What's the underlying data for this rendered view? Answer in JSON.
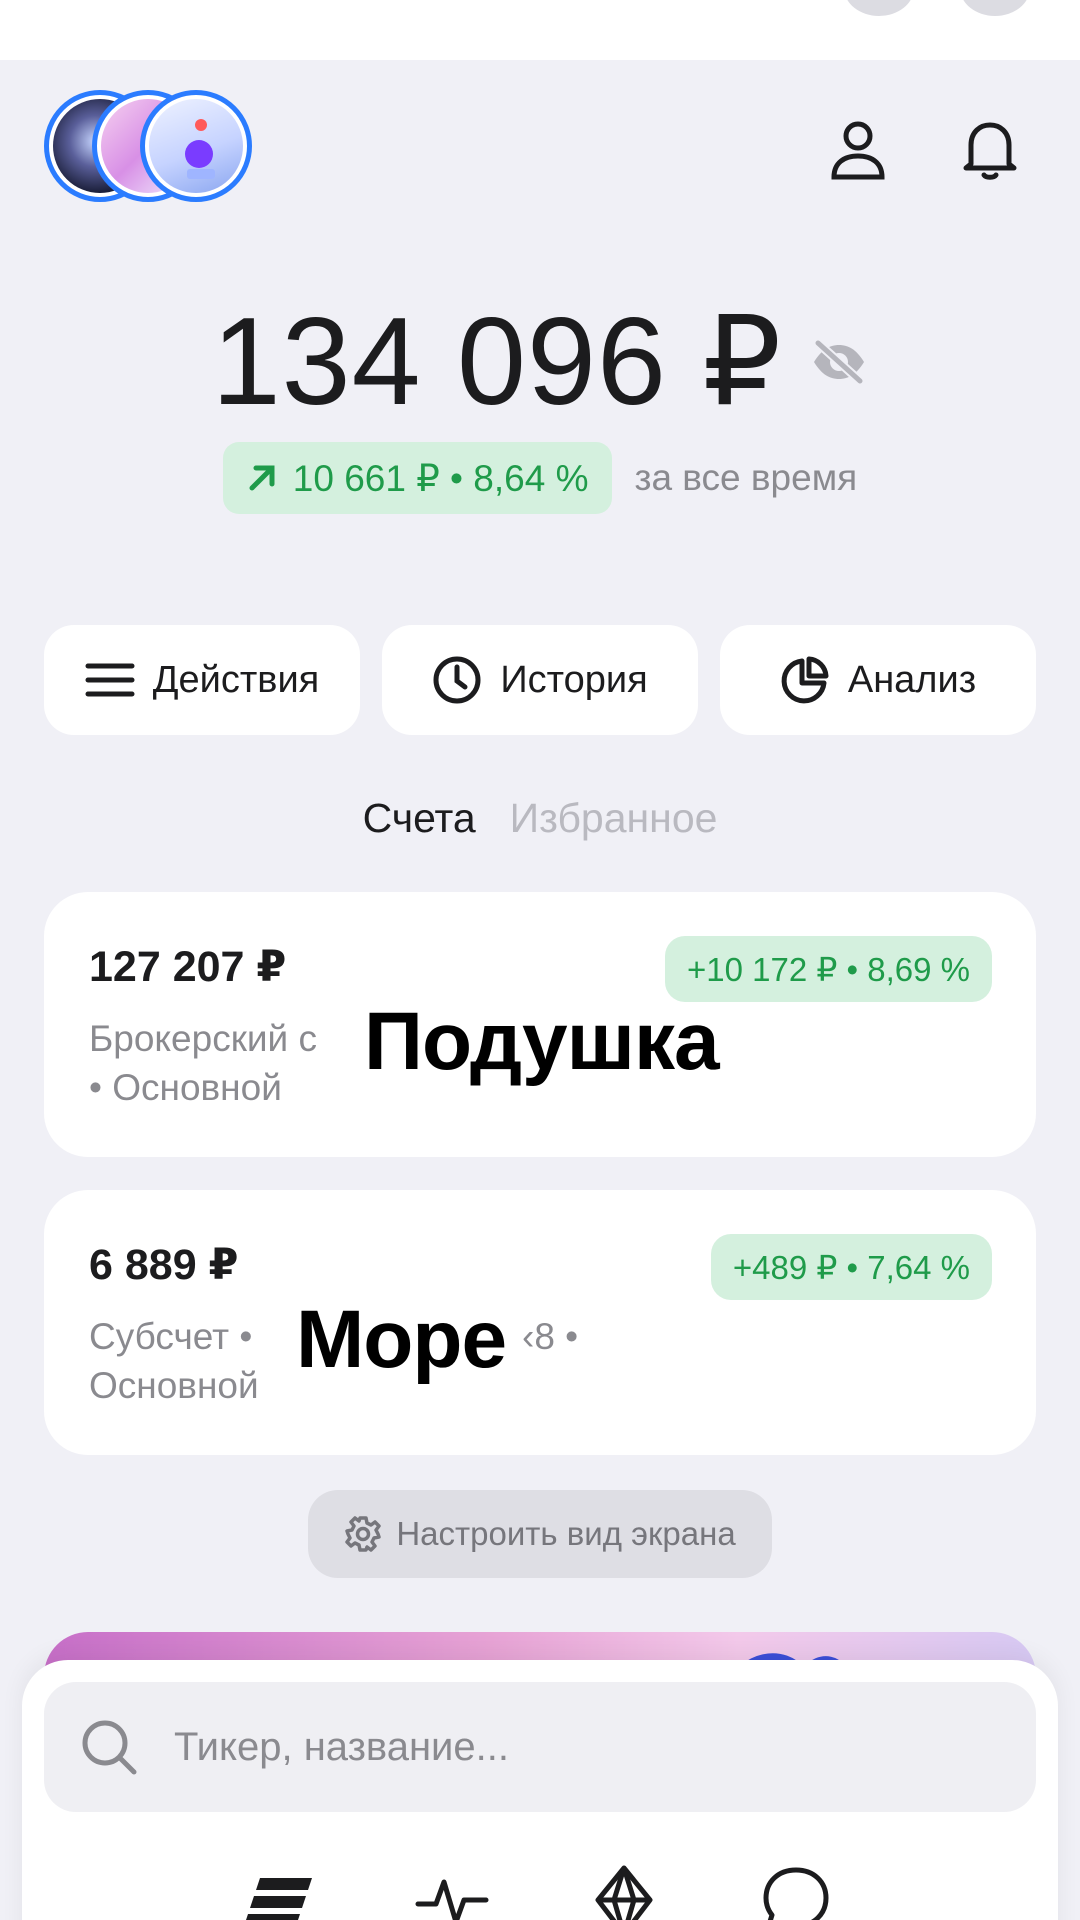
{
  "header": {
    "stories": [
      "story-1",
      "story-2",
      "story-3"
    ],
    "profile_icon": "person-icon",
    "notifications_icon": "bell-icon"
  },
  "balance": {
    "amount": "134 096 ₽",
    "visibility_icon": "eye-off-icon",
    "change": "10 661 ₽ • 8,64 %",
    "change_caption": "за все время"
  },
  "actions": [
    {
      "label": "Действия",
      "icon": "menu-icon"
    },
    {
      "label": "История",
      "icon": "clock-icon"
    },
    {
      "label": "Анализ",
      "icon": "pie-chart-icon"
    }
  ],
  "tabs": {
    "accounts": "Счета",
    "favorites": "Избранное"
  },
  "accounts": [
    {
      "sum": "127 207 ₽",
      "gain": "+10 172 ₽ • 8,69 %",
      "line1": "Брокерский с",
      "line2": "• Основной",
      "overlay": "Подушка"
    },
    {
      "sum": "6 889 ₽",
      "gain": "+489 ₽ • 7,64 %",
      "line1": "Субсчет •",
      "line1_tail": "‹8 •",
      "line2": "Основной",
      "overlay": "Море"
    }
  ],
  "customize": {
    "label": "Настроить вид экрана",
    "icon": "gear-icon"
  },
  "search": {
    "placeholder": "Тикер, название...",
    "value": ""
  },
  "colors": {
    "accent": "#2b7cff",
    "gain_text": "#1f9b4a",
    "gain_bg": "#d4f0de"
  }
}
